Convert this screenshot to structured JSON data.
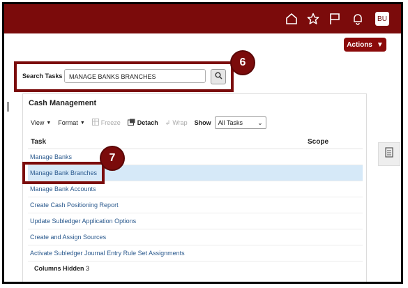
{
  "header": {
    "avatar_initials": "BU",
    "icons": [
      "home-icon",
      "star-icon",
      "flag-icon",
      "bell-icon"
    ]
  },
  "actions_button": {
    "label": "Actions"
  },
  "search": {
    "label": "Search Tasks",
    "value": "MANAGE BANKS BRANCHES"
  },
  "callouts": {
    "search_step": "6",
    "row_step": "7"
  },
  "panel": {
    "title": "Cash Management",
    "toolbar": {
      "view": "View",
      "format": "Format",
      "freeze": "Freeze",
      "detach": "Detach",
      "wrap": "Wrap",
      "show_label": "Show",
      "show_value": "All Tasks"
    },
    "columns": {
      "task": "Task",
      "scope": "Scope"
    },
    "rows": [
      "Manage Banks",
      "Manage Bank Branches",
      "Manage Bank Accounts",
      "Create Cash Positioning Report",
      "Update Subledger Application Options",
      "Create and Assign Sources",
      "Activate Subledger Journal Entry Rule Set Assignments"
    ],
    "selected_row": "Manage Bank Branches",
    "footer_label": "Columns Hidden",
    "footer_count": "3"
  },
  "colors": {
    "brand": "#7b0b0b",
    "link": "#2b5a8e",
    "selected_row": "#d6e9f8"
  }
}
